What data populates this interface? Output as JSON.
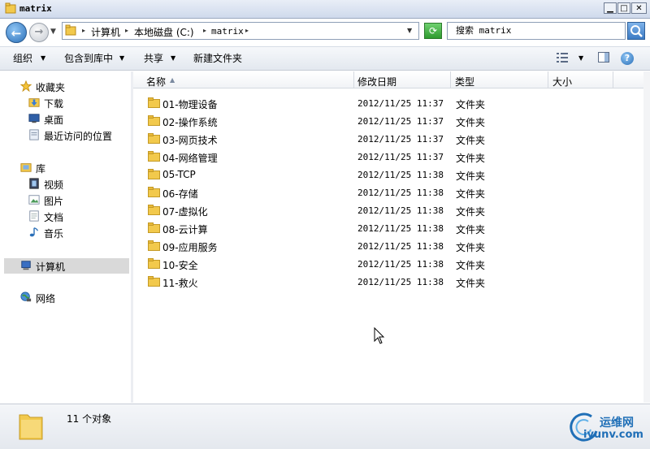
{
  "window": {
    "title": "matrix",
    "min_label": "0",
    "max_label": "1",
    "close_label": "r"
  },
  "address": {
    "breadcrumbs": [
      "计算机",
      "本地磁盘 (C:)",
      "matrix"
    ],
    "search_placeholder": "搜索 matrix"
  },
  "toolbar": {
    "organize": "组织",
    "include_library": "包含到库中",
    "share": "共享",
    "new_folder": "新建文件夹",
    "help": "?"
  },
  "nav": {
    "favorites": "收藏夹",
    "downloads": "下载",
    "desktop": "桌面",
    "recent": "最近访问的位置",
    "libraries": "库",
    "videos": "视频",
    "pictures": "图片",
    "documents": "文档",
    "music": "音乐",
    "computer": "计算机",
    "network": "网络"
  },
  "columns": {
    "name": "名称",
    "date": "修改日期",
    "type": "类型",
    "size": "大小"
  },
  "files": [
    {
      "name": "01-物理设备",
      "date": "2012/11/25 11:37",
      "type": "文件夹"
    },
    {
      "name": "02-操作系统",
      "date": "2012/11/25 11:37",
      "type": "文件夹"
    },
    {
      "name": "03-网页技术",
      "date": "2012/11/25 11:37",
      "type": "文件夹"
    },
    {
      "name": "04-网络管理",
      "date": "2012/11/25 11:37",
      "type": "文件夹"
    },
    {
      "name": "05-TCP",
      "date": "2012/11/25 11:38",
      "type": "文件夹"
    },
    {
      "name": "06-存储",
      "date": "2012/11/25 11:38",
      "type": "文件夹"
    },
    {
      "name": "07-虚拟化",
      "date": "2012/11/25 11:38",
      "type": "文件夹"
    },
    {
      "name": "08-云计算",
      "date": "2012/11/25 11:38",
      "type": "文件夹"
    },
    {
      "name": "09-应用服务",
      "date": "2012/11/25 11:38",
      "type": "文件夹"
    },
    {
      "name": "10-安全",
      "date": "2012/11/25 11:38",
      "type": "文件夹"
    },
    {
      "name": "11-救火",
      "date": "2012/11/25 11:38",
      "type": "文件夹"
    }
  ],
  "status": {
    "count": "11 个对象"
  },
  "watermark": {
    "cn": "运维网",
    "en": "iyunv.com"
  },
  "colors": {
    "folder": "#f2c94c",
    "accent": "#2a6fb8",
    "selection_gray": "#d9d9d9"
  }
}
